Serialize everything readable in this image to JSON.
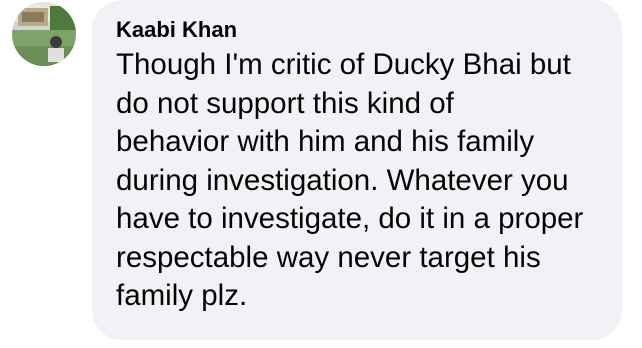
{
  "comment": {
    "author": "Kaabi Khan",
    "text_lines": [
      "Though I'm critic of Ducky Bhai but",
      "do not support this kind of",
      "behavior with him and his family",
      "during investigation. Whatever you",
      "have to investigate, do it in a proper",
      "respectable way never target his",
      "family plz."
    ],
    "bubble_color": "#f0f2f5",
    "text_color": "#050505"
  }
}
